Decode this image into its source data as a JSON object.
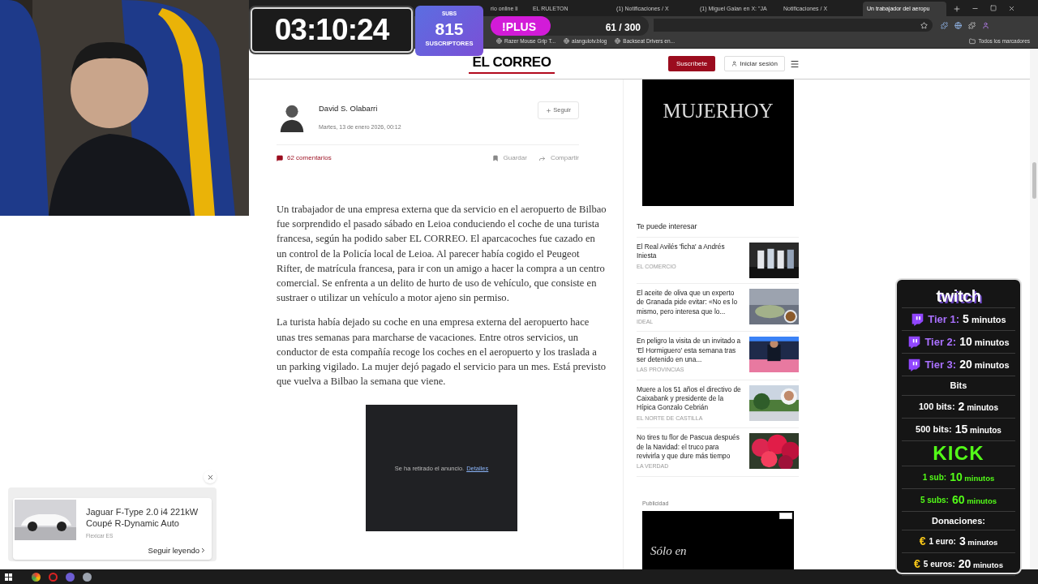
{
  "browser": {
    "tabs": [
      {
        "title": "rio online li",
        "selected": false
      },
      {
        "title": "EL RULETON",
        "selected": false
      },
      {
        "title": "(1) Notificaciones / X",
        "selected": false
      },
      {
        "title": "(1) Miguel Galan en X: \"JA",
        "selected": false
      },
      {
        "title": "Notificaciones / X",
        "selected": false
      },
      {
        "title": "Un trabajador del aeropu",
        "selected": true
      }
    ],
    "bookmarks": [
      "Razer Mouse Grip T...",
      "alangulotv.blog",
      "Backseat Drivers en..."
    ],
    "all_bookmarks": "Todos los marcadores"
  },
  "stream_overlay": {
    "timer": "03:10:24",
    "subs": {
      "label": "SUBS",
      "count": "815",
      "caption": "SUSCRIPTORES"
    },
    "plus": {
      "label": "!PLUS",
      "progress": "61 / 300",
      "level": 0.38
    }
  },
  "site_header": {
    "logo": "EL CORREO",
    "subscribe": "Suscríbete",
    "login": "Iniciar sesión"
  },
  "article": {
    "author": "David S. Olabarri",
    "date": "Martes, 13 de enero 2026, 00:12",
    "follow": "Seguir",
    "comments": "62 comentarios",
    "save": "Guardar",
    "share": "Compartir",
    "paragraphs": [
      "Un trabajador de una empresa externa que da servicio en el aeropuerto de Bilbao fue sorprendido el pasado sábado en Leioa conduciendo el coche de una turista francesa, según ha podido saber EL CORREO. El aparcacoches fue cazado en un control de la Policía local de Leioa. Al parecer había cogido el Peugeot Rifter, de matrícula francesa, para ir con un amigo a hacer la compra a un centro comercial. Se enfrenta a un delito de hurto de uso de vehículo, que consiste en sustraer o utilizar un vehículo a motor ajeno sin permiso.",
      "La turista había dejado su coche en una empresa externa del aeropuerto hace unas tres semanas para marcharse de vacaciones. Entre otros servicios, un conductor de esta compañía recoge los coches en el aeropuerto y los traslada a un parking vigilado. La mujer dejó pagado el servicio para un mes. Está previsto que vuelva a Bilbao la semana que viene."
    ],
    "removed_ad": {
      "message": "Se ha retirado el anuncio.",
      "link": "Detalles"
    }
  },
  "sidebar": {
    "top_ad": "MUJERHOY",
    "heading": "Te puede interesar",
    "items": [
      {
        "title": "El Real Avilés 'ficha' a Andrés Iniesta",
        "source": "EL COMERCIO"
      },
      {
        "title": "El aceite de oliva que un experto de Granada pide evitar: «No es lo mismo, pero interesa que lo...",
        "source": "IDEAL"
      },
      {
        "title": "En peligro la visita de un invitado a 'El Hormiguero' esta semana tras ser detenido en una...",
        "source": "LAS PROVINCIAS"
      },
      {
        "title": "Muere a los 51 años el directivo de Caixabank y presidente de la Hípica Gonzalo Cebrián",
        "source": "EL NORTE DE CASTILLA"
      },
      {
        "title": "No tires tu flor de Pascua después de la Navidad: el truco para revivirla y que dure más tiempo",
        "source": "LA VERDAD"
      }
    ],
    "ad_label": "Publicidad",
    "bottom_ad": "Sólo en"
  },
  "floating_ad": {
    "title": "Jaguar F-Type 2.0 i4 221kW Coupé R-Dynamic Auto",
    "advertiser": "Flexicar ES",
    "cta": "Seguir leyendo"
  },
  "donation_panel": {
    "logo": "twitch",
    "tiers": [
      {
        "label": "Tier 1:",
        "value": "5",
        "unit": "minutos"
      },
      {
        "label": "Tier 2:",
        "value": "10",
        "unit": "minutos"
      },
      {
        "label": "Tier 3:",
        "value": "20",
        "unit": "minutos"
      }
    ],
    "bits_heading": "Bits",
    "bits": [
      {
        "label": "100 bits:",
        "value": "2",
        "unit": "minutos"
      },
      {
        "label": "500 bits:",
        "value": "15",
        "unit": "minutos"
      }
    ],
    "kick_logo": "KICK",
    "kick": [
      {
        "label": "1 sub:",
        "value": "10",
        "unit": "minutos"
      },
      {
        "label": "5 subs:",
        "value": "60",
        "unit": "minutos"
      }
    ],
    "donations_heading": "Donaciones:",
    "donations": [
      {
        "symbol": "€",
        "label": "1 euro:",
        "value": "3",
        "unit": "minutos"
      },
      {
        "symbol": "€",
        "label": "5 euros:",
        "value": "20",
        "unit": "minutos"
      }
    ]
  }
}
